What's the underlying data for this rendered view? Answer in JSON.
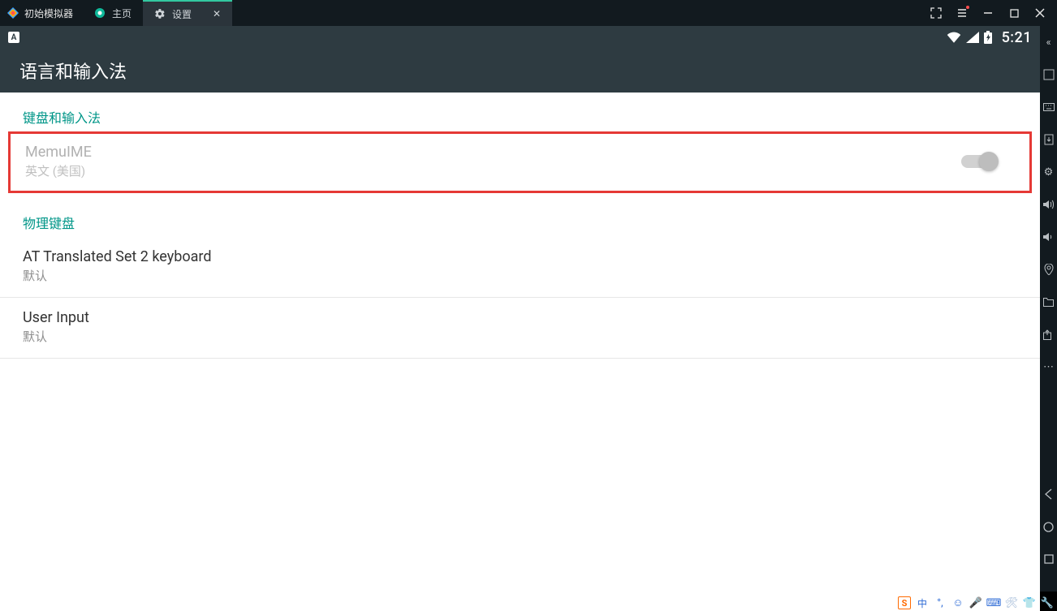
{
  "titlebar": {
    "app_name": "初始模拟器",
    "tabs": [
      {
        "label": "主页",
        "icon": "home-icon",
        "active": false
      },
      {
        "label": "设置",
        "icon": "gear-icon",
        "active": true
      }
    ]
  },
  "status": {
    "indicator": "A",
    "clock": "5:21"
  },
  "header": {
    "title": "语言和输入法"
  },
  "sections": [
    {
      "title": "键盘和输入法",
      "items": [
        {
          "title": "MemuIME",
          "subtitle": "英文 (美国)",
          "disabled": true,
          "highlight": true,
          "switch": {
            "on": false
          }
        }
      ]
    },
    {
      "title": "物理键盘",
      "items": [
        {
          "title": "AT Translated Set 2 keyboard",
          "subtitle": "默认"
        },
        {
          "title": "User Input",
          "subtitle": "默认"
        }
      ]
    }
  ],
  "tray": {
    "ime_badge": "S",
    "lang": "中"
  },
  "colors": {
    "accent": "#009688",
    "highlight_border": "#e53935",
    "header_bg": "#2e3b41",
    "titlebar_bg": "#121a1f"
  }
}
